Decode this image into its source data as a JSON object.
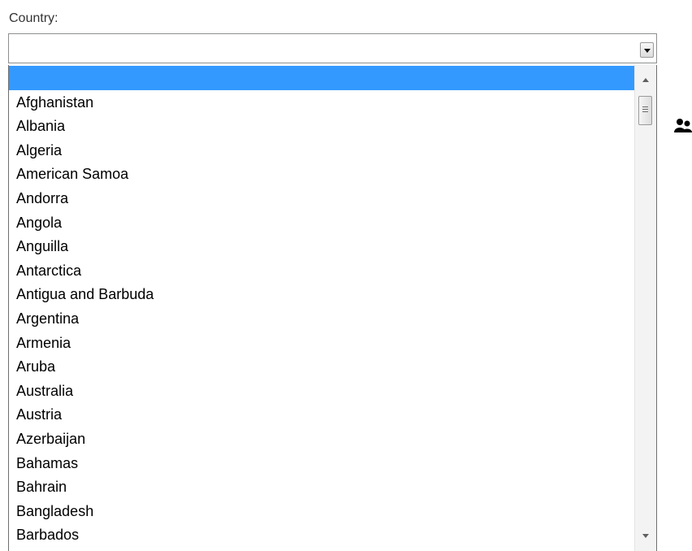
{
  "country_field": {
    "label": "Country:",
    "selected_value": ""
  },
  "options": [
    "",
    "Afghanistan",
    "Albania",
    "Algeria",
    "American Samoa",
    "Andorra",
    "Angola",
    "Anguilla",
    "Antarctica",
    "Antigua and Barbuda",
    "Argentina",
    "Armenia",
    "Aruba",
    "Australia",
    "Austria",
    "Azerbaijan",
    "Bahamas",
    "Bahrain",
    "Bangladesh",
    "Barbados"
  ],
  "highlighted_index": 0,
  "colors": {
    "highlight": "#3399ff",
    "text": "#000000",
    "label": "#333333"
  },
  "icons": {
    "dropdown": "chevron-down-icon",
    "scroll_up": "arrow-up-icon",
    "scroll_down": "arrow-down-icon",
    "side": "user-icon"
  }
}
